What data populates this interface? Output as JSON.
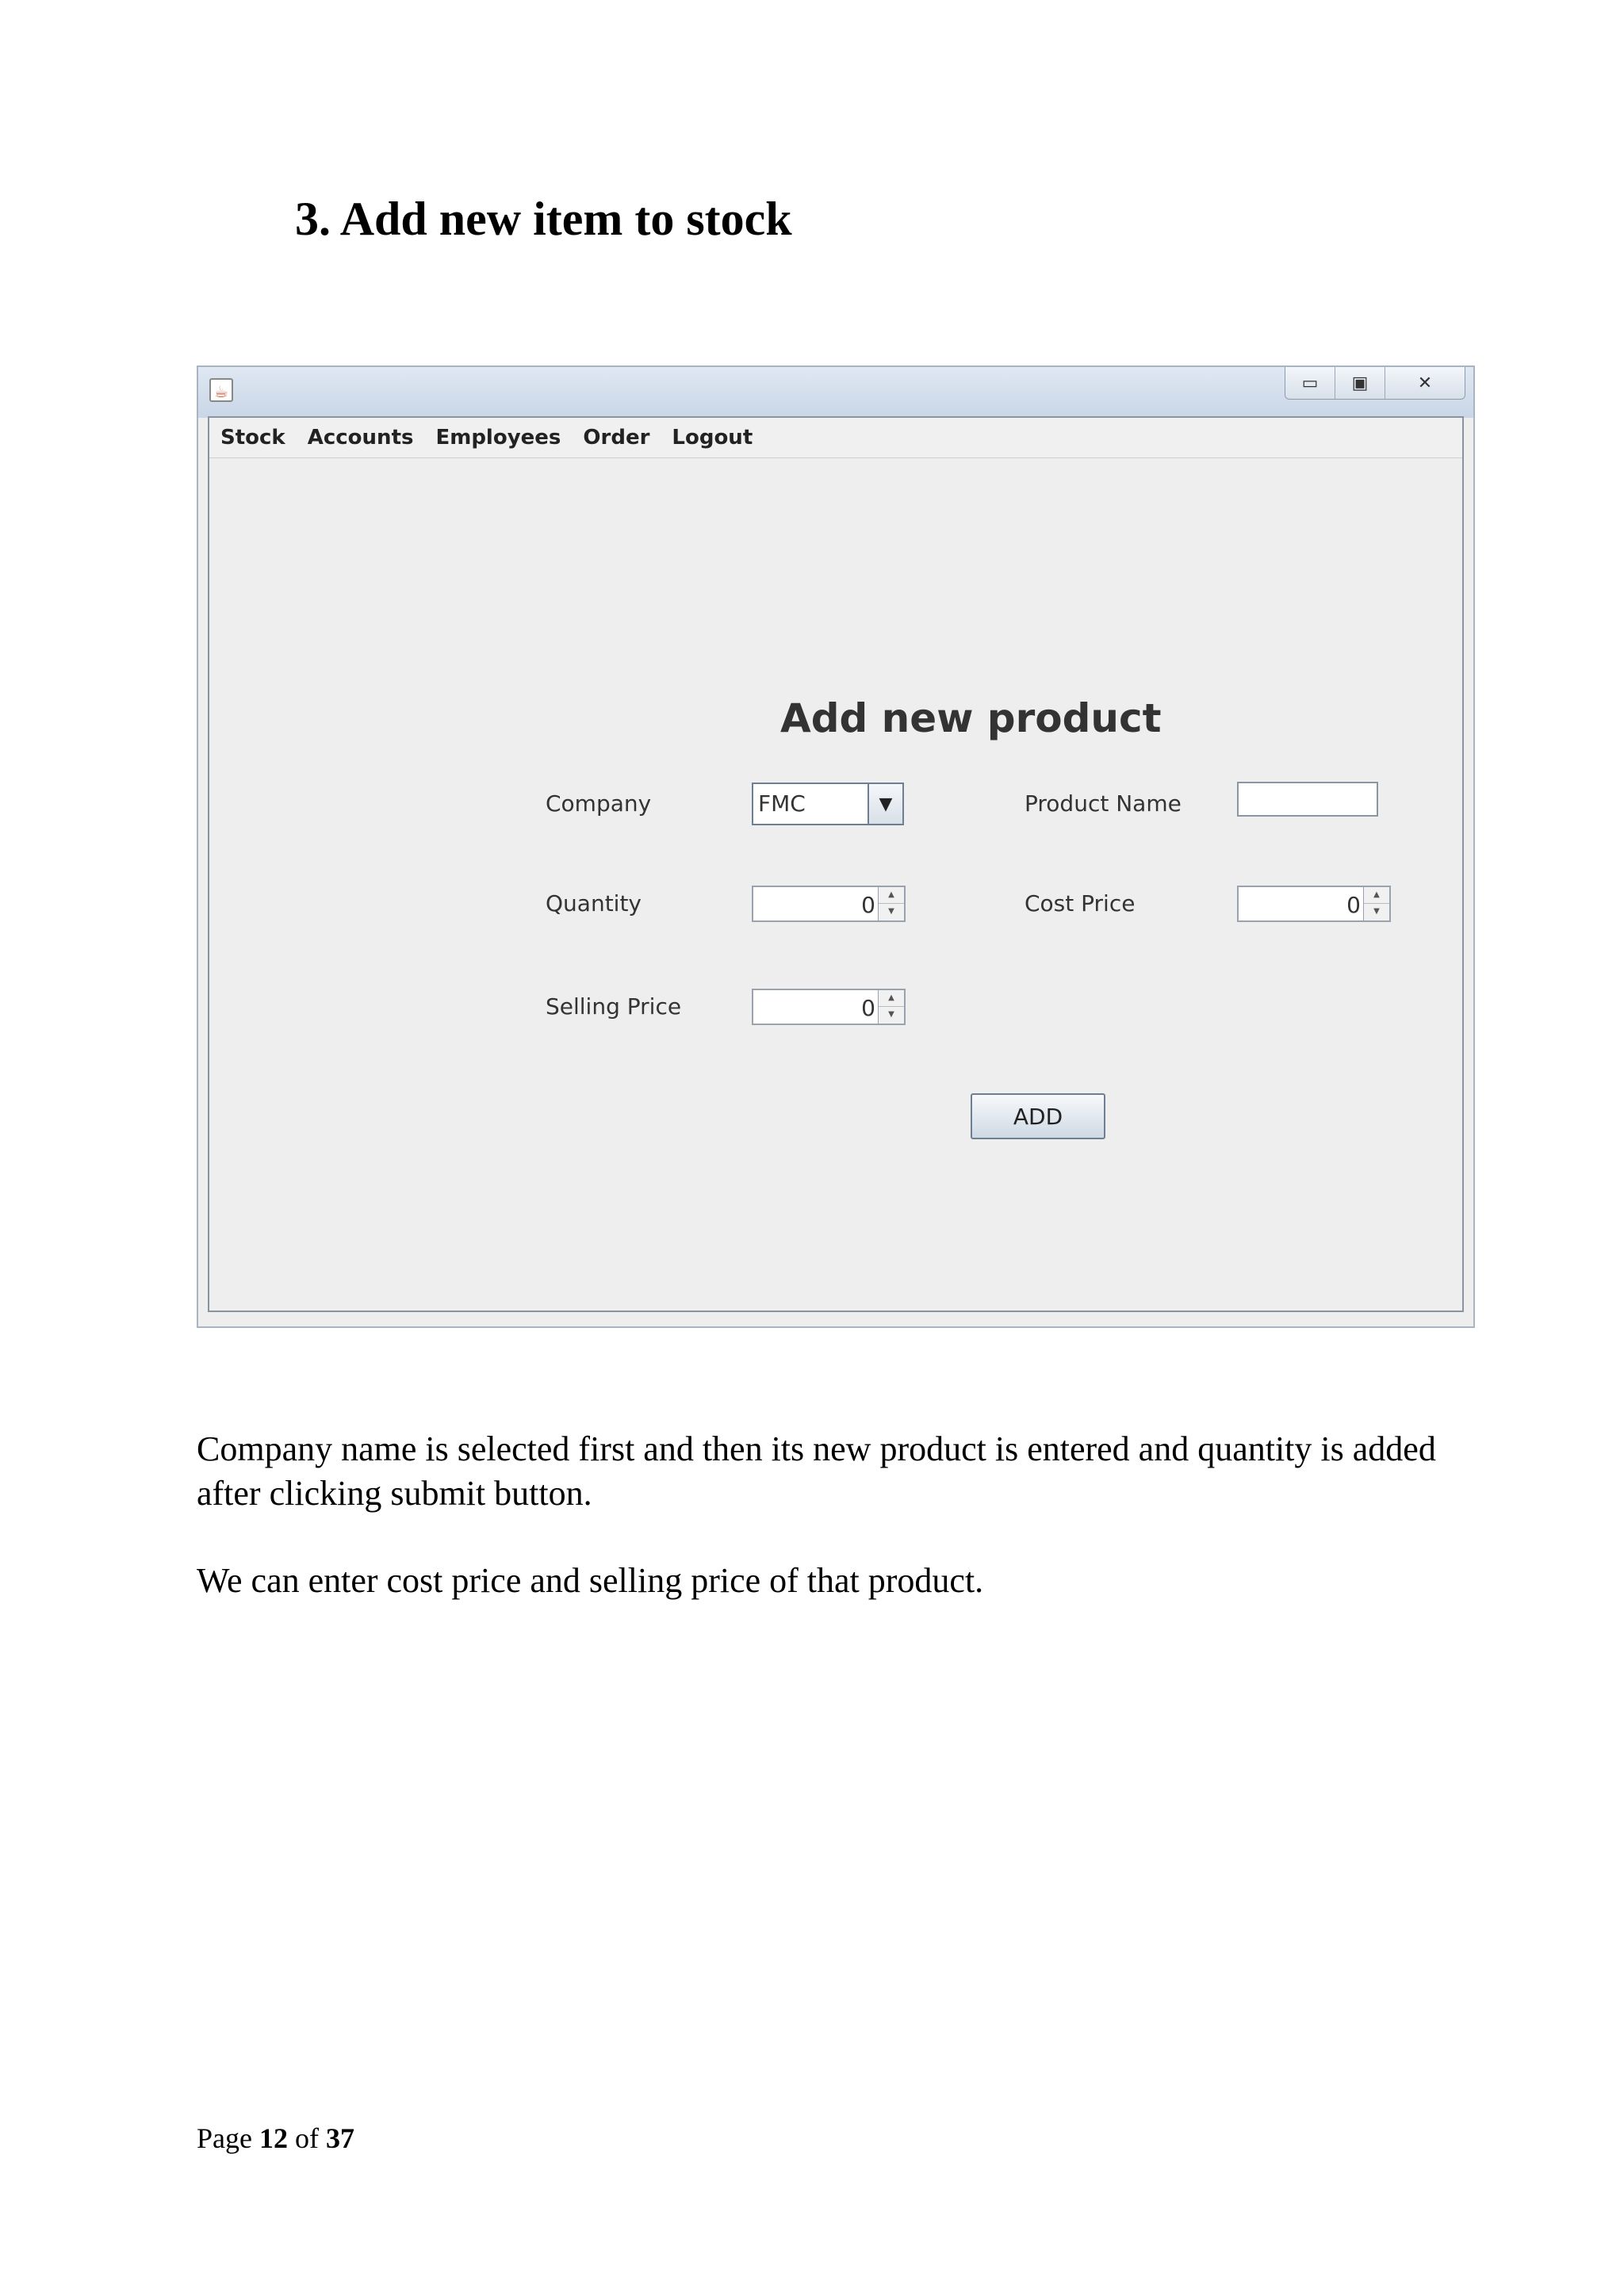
{
  "heading": "3. Add new item to stock",
  "window": {
    "app_icon": "java-icon",
    "controls": {
      "minimize": "▭",
      "maximize": "▣",
      "close": "✕"
    },
    "menu": [
      "Stock",
      "Accounts",
      "Employees",
      "Order",
      "Logout"
    ],
    "form": {
      "title": "Add new product",
      "company_label": "Company",
      "company_value": "FMC",
      "product_name_label": "Product Name",
      "product_name_value": "",
      "quantity_label": "Quantity",
      "quantity_value": "0",
      "cost_price_label": "Cost Price",
      "cost_price_value": "0",
      "selling_price_label": "Selling Price",
      "selling_price_value": "0",
      "add_button": "ADD"
    }
  },
  "body": {
    "para1": "Company name is selected first and then its new product is entered and quantity is added after clicking submit button.",
    "para2": "We can enter cost price and selling price of that product."
  },
  "footer": {
    "prefix": "Page",
    "page": "12",
    "of": "of",
    "total": "37"
  }
}
